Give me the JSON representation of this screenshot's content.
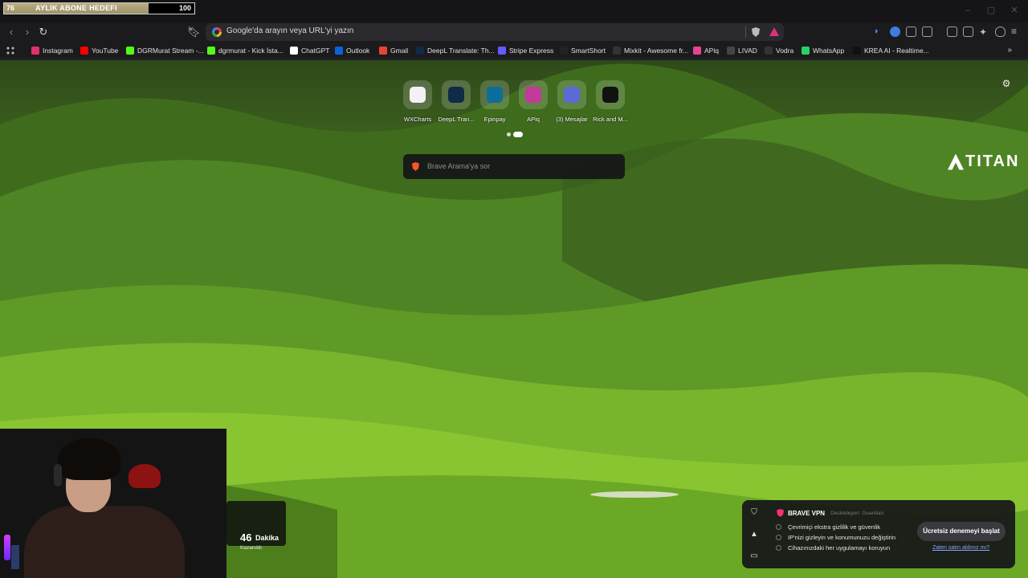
{
  "stream_overlay": {
    "goal_current": "76",
    "goal_label": "AYLIK ABONE HEDEFI",
    "goal_target": "100",
    "goal_progress": 0.76
  },
  "toolbar": {
    "address_placeholder": "Google'da arayın veya URL'yi yazın",
    "icons": [
      "back-icon",
      "forward-icon",
      "reload-icon",
      "bookmark-icon",
      "brave-shields-icon",
      "brave-rewards-icon",
      "sidebar-icon",
      "wallet-icon",
      "vpn-icon",
      "menu-icon"
    ]
  },
  "bookmarks": [
    {
      "label": "Instagram",
      "color": "#e1306c"
    },
    {
      "label": "YouTube",
      "color": "#ff0000"
    },
    {
      "label": "DGRMurat Stream -...",
      "color": "#53fc18"
    },
    {
      "label": "dgrmurat - Kick İsta...",
      "color": "#53fc18"
    },
    {
      "label": "ChatGPT",
      "color": "#ffffff"
    },
    {
      "label": "Outlook",
      "color": "#0a64d8"
    },
    {
      "label": "Gmail",
      "color": "#ea4335"
    },
    {
      "label": "DeepL Translate: Th...",
      "color": "#0f2b46"
    },
    {
      "label": "Stripe Express",
      "color": "#635bff"
    },
    {
      "label": "SmartShort",
      "color": "#222222"
    },
    {
      "label": "Mixkit - Awesome fr...",
      "color": "#333333"
    },
    {
      "label": "APiq",
      "color": "#e84393"
    },
    {
      "label": "LIVAD",
      "color": "#444444"
    },
    {
      "label": "Vodra",
      "color": "#333333"
    },
    {
      "label": "WhatsApp",
      "color": "#25d366"
    },
    {
      "label": "KREA AI - Realtime...",
      "color": "#111111"
    }
  ],
  "top_sites": [
    {
      "label": "WXCharts",
      "color": "#f5f0f5"
    },
    {
      "label": "DeepL Tran...",
      "color": "#0f2b46"
    },
    {
      "label": "Epinpay",
      "color": "#0d6e9b"
    },
    {
      "label": "APiq",
      "color": "#c23a9a"
    },
    {
      "label": "(3) Mesajlar",
      "color": "#5b6bd6"
    },
    {
      "label": "Rick and M...",
      "color": "#111111"
    }
  ],
  "search": {
    "placeholder": "Brave Arama'ya sor"
  },
  "brand_logo": {
    "text": "TITAN"
  },
  "timer": {
    "value": "46",
    "unit": "Dakika",
    "subtitle": "Kazanıldı"
  },
  "vpn": {
    "title": "BRAVE VPN",
    "powered_by": "Destekleyen: Guardian",
    "features": [
      "Çevrimiçi ekstra gizlilik ve güvenlik",
      "IP'nizi gizleyin ve konumunuzu değiştirin",
      "Cihazınızdaki her uygulamayı koruyun"
    ],
    "cta": "Ücretsiz denemeyi başlat",
    "link": "Zaten satın aldınız mı?"
  }
}
